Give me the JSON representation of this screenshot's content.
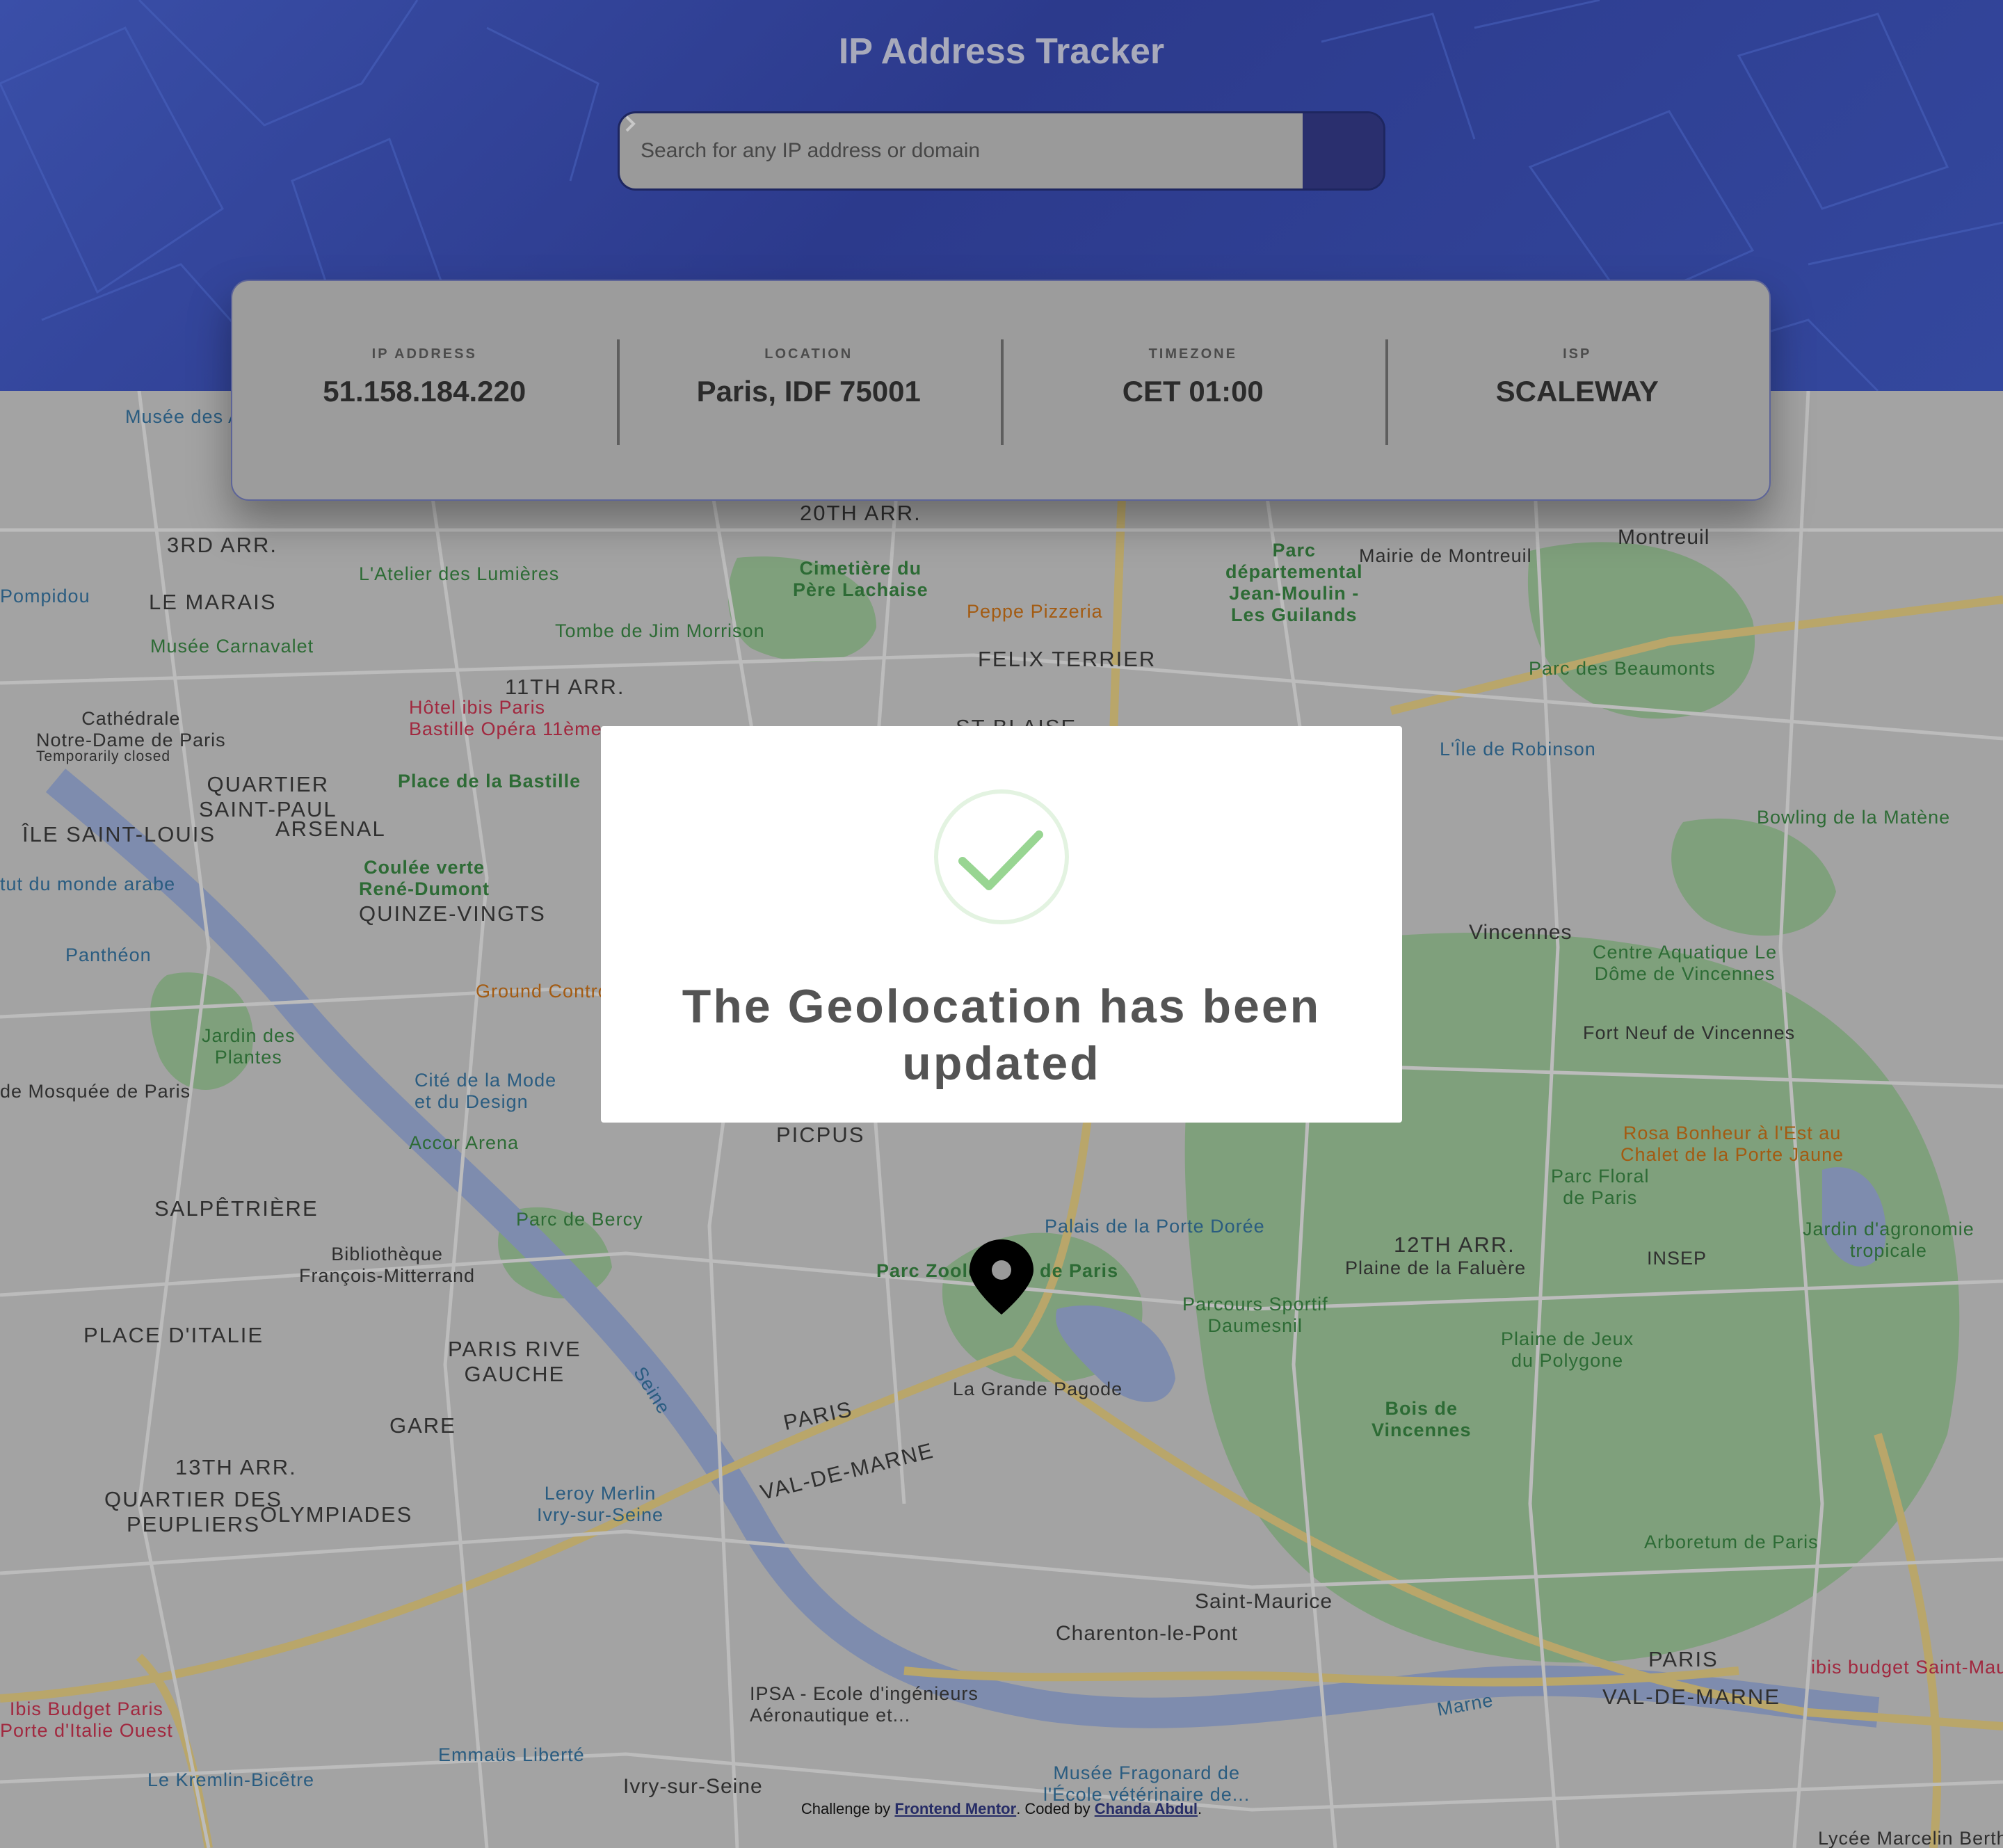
{
  "app": {
    "title": "IP Address Tracker"
  },
  "search": {
    "placeholder": "Search for any IP address or domain",
    "button_icon": "chevron-right-icon"
  },
  "stats": [
    {
      "label": "IP ADDRESS",
      "value": "51.158.184.220"
    },
    {
      "label": "LOCATION",
      "value": "Paris, IDF 75001"
    },
    {
      "label": "TIMEZONE",
      "value": "CET 01:00"
    },
    {
      "label": "ISP",
      "value": "SCALEWAY"
    }
  ],
  "modal": {
    "icon": "check-circle-icon",
    "message": "The Geolocation has been updated"
  },
  "map": {
    "marker_icon": "location-pin-icon",
    "labels": {
      "l01": "Musée des A",
      "l02": "3RD ARR.",
      "l03": "LE MARAIS",
      "l04": "Pompidou",
      "l05": "Musée Carnavalet",
      "l06": "Cathédrale\nNotre-Dame de Paris",
      "l07": "Temporarily closed",
      "l08": "QUARTIER\nSAINT-PAUL",
      "l09": "ÎLE SAINT-LOUIS",
      "l10": "ARSENAL",
      "l11": "tut du monde arabe",
      "l12": "Panthéon",
      "l13": "Jardin des\nPlantes",
      "l14": "de Mosquée de Paris",
      "l15": "SALPÊTRIÈRE",
      "l16": "PLACE D'ITALIE",
      "l17": "13TH ARR.",
      "l18": "QUARTIER DES\nPEUPLIERS",
      "l19": "OLYMPIADES",
      "l20": "Ibis Budget Paris\nPorte d'Italie Ouest",
      "l21": "Le Kremlin-Bicêtre",
      "l22": "Emmaüs Liberté",
      "l23": "Ivry-sur-Seine",
      "l24": "Leroy Merlin\nIvry-sur-Seine",
      "l25": "PARIS RIVE\nGAUCHE",
      "l26": "GARE",
      "l27": "Bibliothèque\nFrançois-Mitterrand",
      "l28": "Parc de Bercy",
      "l29": "Accor Arena",
      "l30": "Cité de la Mode\net du Design",
      "l31": "Ground Contro",
      "l32": "Coulée verte\nRené-Dumont",
      "l33": "QUINZE-VINGTS",
      "l34": "Place de la Bastille",
      "l35": "Hôtel ibis Paris\nBastille Opéra 11ème",
      "l36": "11TH ARR.",
      "l37": "L'Atelier des Lumières",
      "l38": "20TH ARR.",
      "l39": "Cimetière du\nPère Lachaise",
      "l40": "Tombe de Jim Morrison",
      "l41": "Peppe Pizzeria",
      "l42": "FELIX TERRIER",
      "l43": "ST BLAISE",
      "l44": "Parc\ndépartemental\nJean-Moulin -\nLes Guilands",
      "l45": "Mairie de Montreuil",
      "l46": "Montreuil",
      "l47": "Parc des Beaumonts",
      "l48": "L'Île de Robinson",
      "l49": "Bowling de la Matène",
      "l50": "Vincennes",
      "l51": "Centre Aquatique Le\nDôme de Vincennes",
      "l52": "Fort Neuf de Vincennes",
      "l53": "Rosa Bonheur à l'Est au\nChalet de la Porte Jaune",
      "l54": "Parc Floral\nde Paris",
      "l55": "Jardin d'agronomie\ntropicale",
      "l56": "12TH ARR.",
      "l57": "Plaine de la Faluère",
      "l58": "INSEP",
      "l59": "Parcours Sportif\nDaumesnil",
      "l60": "Plaine de Jeux\ndu Polygone",
      "l61": "Bois de\nVincennes",
      "l62": "Arboretum de Paris",
      "l63": "Palais de la Porte Dorée",
      "l64": "Parc Zoologique de Paris",
      "l65": "La Grande Pagode",
      "l66": "PICPUS",
      "l67": "PARIS",
      "l68": "VAL-DE-MARNE",
      "l69": "Saint-Maurice",
      "l70": "Charenton-le-Pont",
      "l71": "PARIS",
      "l72": "VAL-DE-MARNE",
      "l73": "ibis budget Saint-Maur",
      "l74": "IPSA - Ecole d'ingénieurs\nAéronautique et...",
      "l75": "Musée Fragonard de\nl'École vétérinaire de...",
      "l76": "Lycée Marcelin Berthelot",
      "l77": "Seine",
      "l78": "Marne"
    }
  },
  "attribution": {
    "prefix": "Challenge by ",
    "link1": "Frontend Mentor",
    "middle": ". Coded by ",
    "link2": "Chanda Abdul",
    "suffix": "."
  },
  "colors": {
    "header_bg": "#34489e",
    "search_button": "#2a2f6e",
    "success_green": "#8ed08a"
  }
}
